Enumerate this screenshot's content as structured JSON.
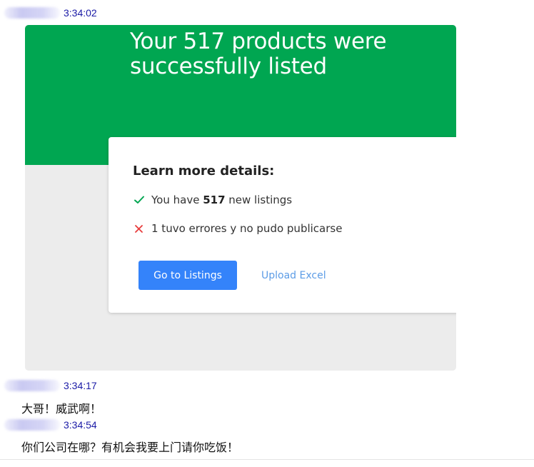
{
  "messages": [
    {
      "timestamp": "3:34:02"
    },
    {
      "timestamp": "3:34:17",
      "text": "大哥！威武啊！"
    },
    {
      "timestamp": "3:34:54",
      "text": "你们公司在哪？有机会我要上门请你吃饭！"
    }
  ],
  "screenshot": {
    "banner_title": "Your 517 products were successfully listed",
    "card_title": "Learn more details:",
    "success_prefix": "You have ",
    "success_count": "517",
    "success_suffix": " new listings",
    "error_text": "1 tuvo errores y no pudo publicarse",
    "primary_button": "Go to Listings",
    "link_button": "Upload Excel",
    "colors": {
      "banner": "#00a651",
      "primary": "#3483fa",
      "link": "#5c9ce6",
      "check": "#00a651",
      "error": "#e83d3d"
    }
  }
}
